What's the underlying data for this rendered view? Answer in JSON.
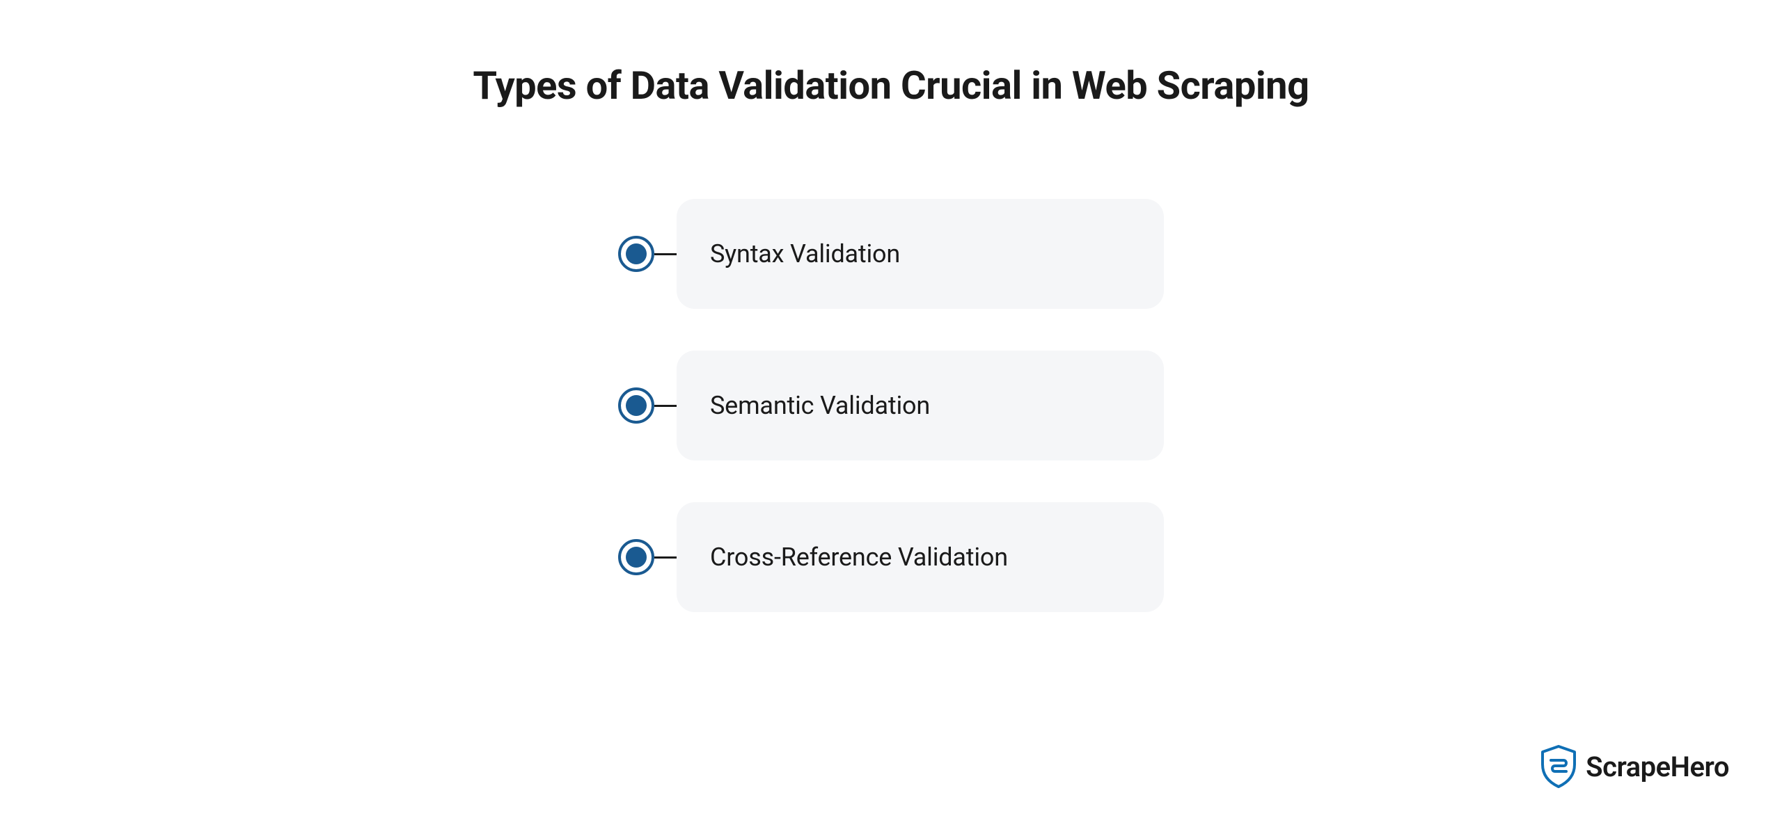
{
  "title": "Types of Data Validation Crucial in Web Scraping",
  "items": [
    {
      "label": "Syntax Validation"
    },
    {
      "label": "Semantic Validation"
    },
    {
      "label": "Cross-Reference Validation"
    }
  ],
  "brand": {
    "name": "ScrapeHero",
    "accent_color": "#0f6fb5"
  }
}
